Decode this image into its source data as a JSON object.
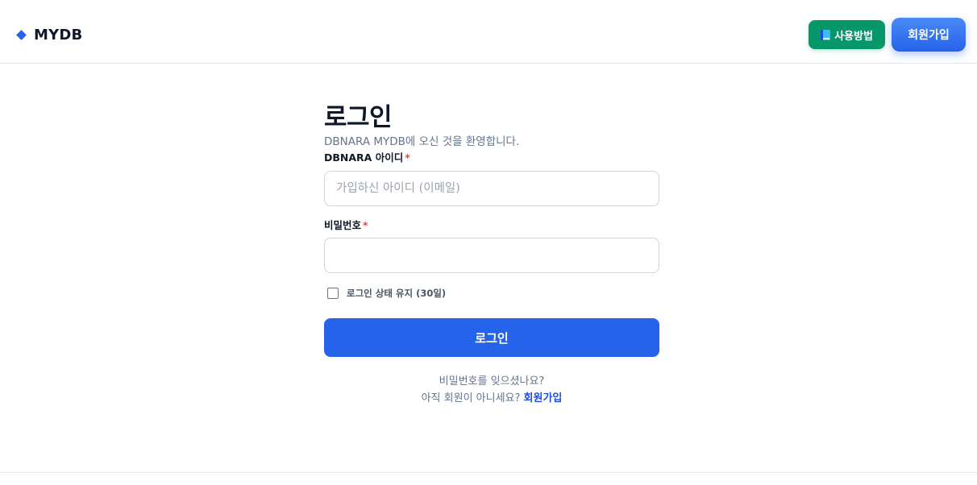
{
  "header": {
    "brand": "MYDB",
    "guide_button": "사용방법",
    "signup_button": "회원가입"
  },
  "login": {
    "title": "로그인",
    "subtitle": "DBNARA MYDB에 오신 것을 환영합니다.",
    "id_label": "DBNARA 아이디",
    "id_placeholder": "가입하신 아이디 (이메일)",
    "password_label": "비밀번호",
    "required_mark": "*",
    "remember_label": "로그인 상태 유지 (30일)",
    "submit": "로그인",
    "forgot_password": "비밀번호를 잊으셨나요?",
    "no_account": "아직 회원이 아니세요?",
    "signup_link": "회원가입"
  },
  "colors": {
    "primary": "#2563eb",
    "guide_green": "#059669",
    "required_red": "#ef4444"
  }
}
